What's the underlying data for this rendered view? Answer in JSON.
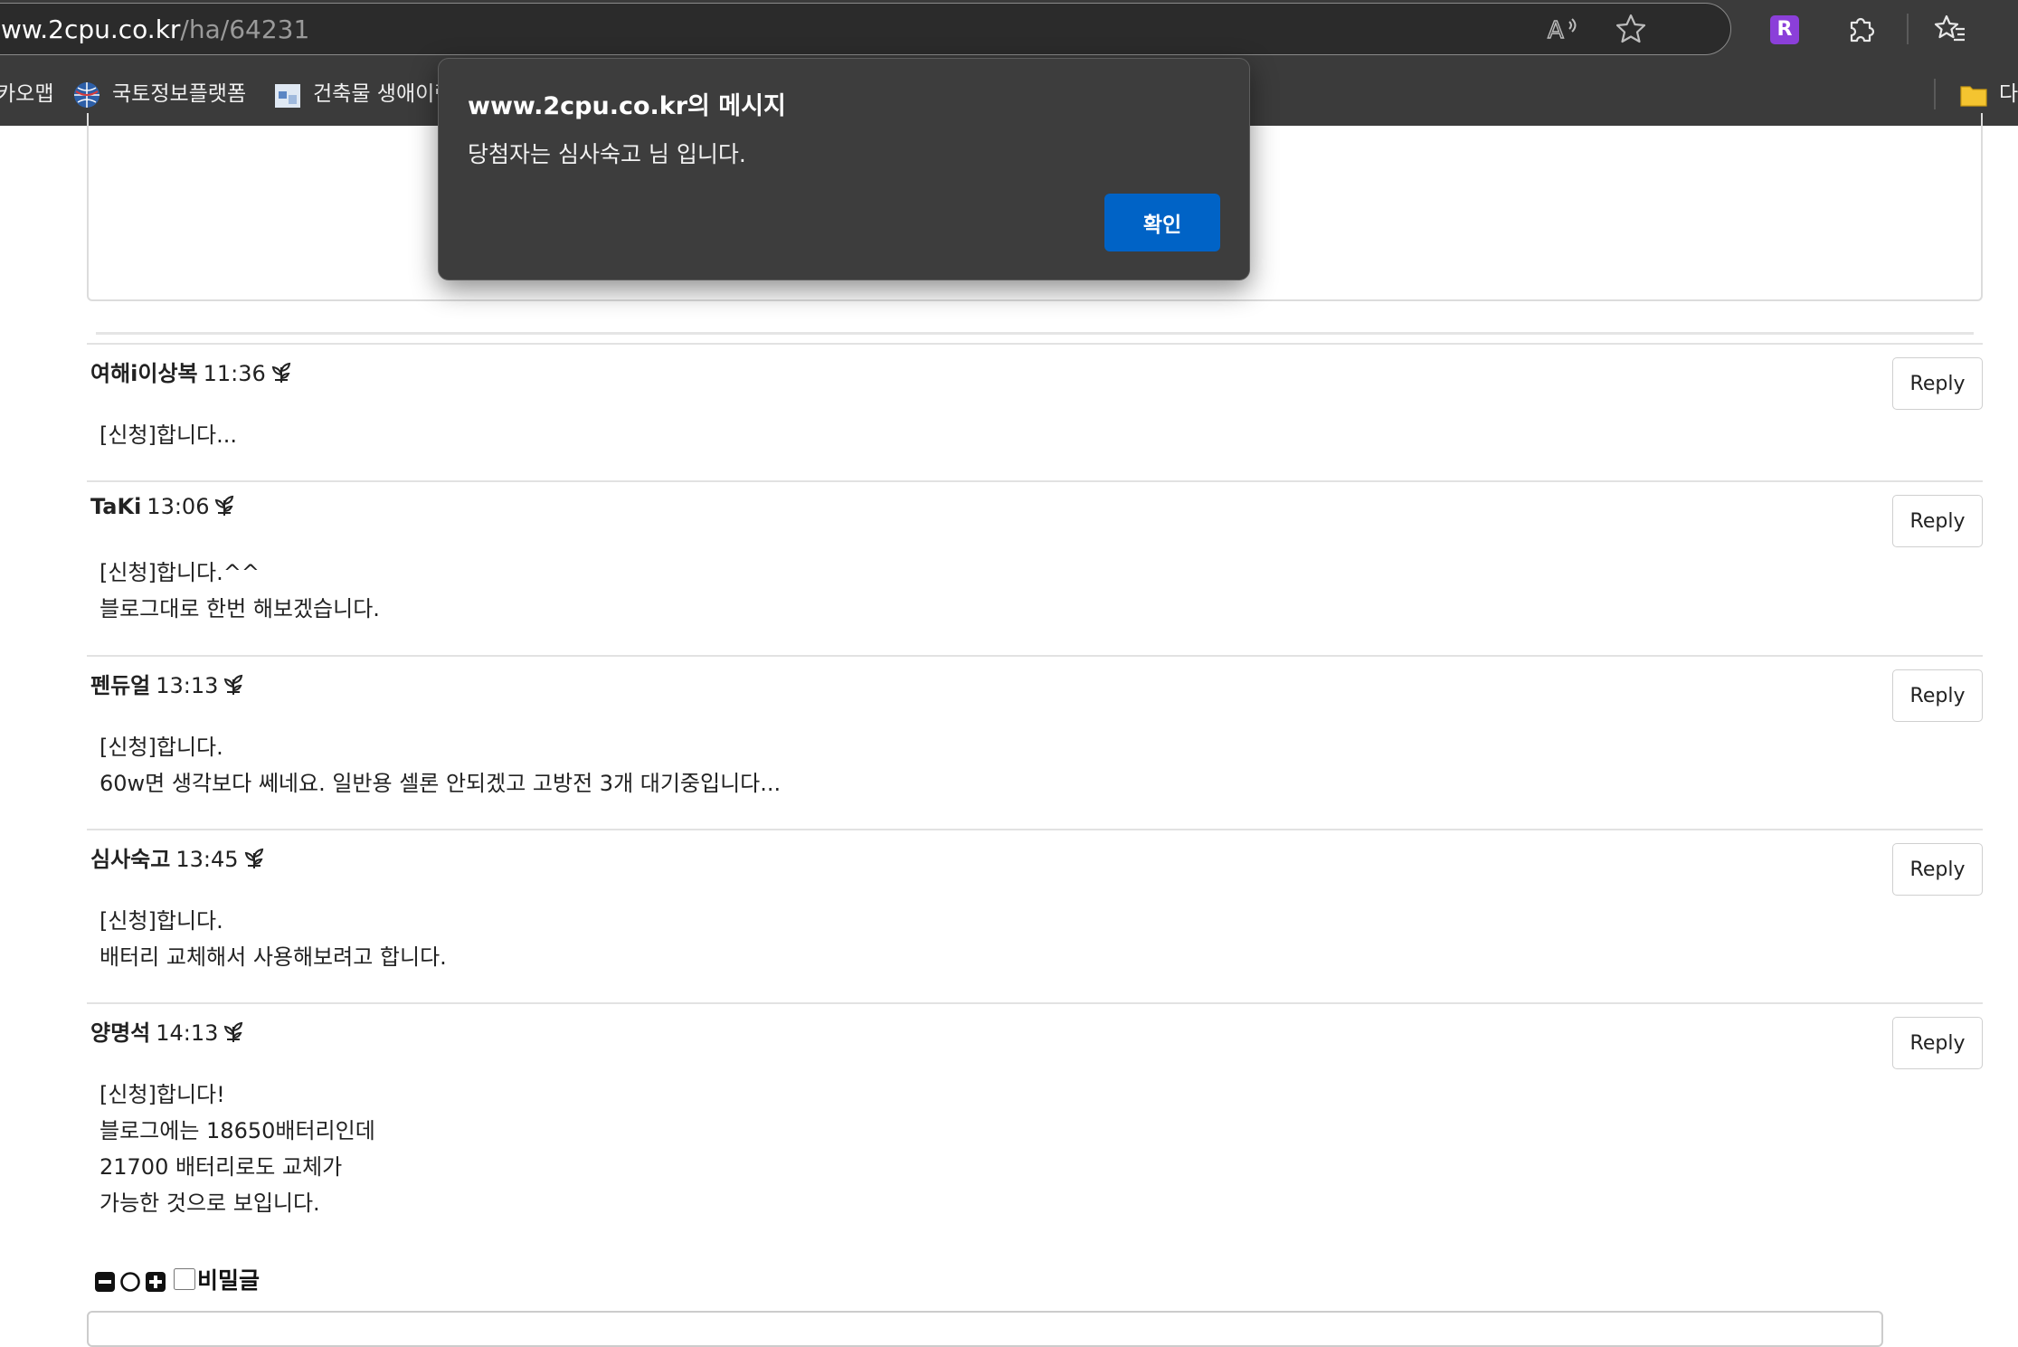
{
  "browser": {
    "url_host": "ww.2cpu.co.kr",
    "url_path": "/ha/64231",
    "profile_initial": "R",
    "bookmarks": [
      {
        "label": "카오맵"
      },
      {
        "label": "국토정보플랫폼"
      },
      {
        "label": "건축물 생애이력"
      },
      {
        "label": "다"
      }
    ]
  },
  "dialog": {
    "title": "www.2cpu.co.kr의 메시지",
    "message": "당첨자는 심사숙고 님 입니다.",
    "ok_label": "확인",
    "ok_color": "#0063c6"
  },
  "comments": [
    {
      "author": "여해i이상복",
      "time": "11:36",
      "lines": [
        "[신청]합니다..."
      ],
      "reply_label": "Reply"
    },
    {
      "author": "TaKi",
      "time": "13:06",
      "lines": [
        "[신청]합니다.^^",
        "블로그대로 한번 해보겠습니다."
      ],
      "reply_label": "Reply"
    },
    {
      "author": "펜듀얼",
      "time": "13:13",
      "lines": [
        "[신청]합니다.",
        "60w면 생각보다 쎄네요. 일반용 셀론 안되겠고 고방전 3개 대기중입니다..."
      ],
      "reply_label": "Reply"
    },
    {
      "author": "심사숙고",
      "time": "13:45",
      "lines": [
        "[신청]합니다.",
        "배터리 교체해서 사용해보려고 합니다."
      ],
      "reply_label": "Reply"
    },
    {
      "author": "양명석",
      "time": "14:13",
      "lines": [
        "[신청]합니다!",
        "블로그에는 18650배터리인데",
        "21700 배터리로도 교체가",
        "가능한 것으로 보입니다."
      ],
      "reply_label": "Reply"
    }
  ],
  "comment_tools": {
    "secret_label": "비밀글",
    "icons": [
      "minus-box-icon",
      "circle-icon",
      "plus-box-icon"
    ]
  }
}
